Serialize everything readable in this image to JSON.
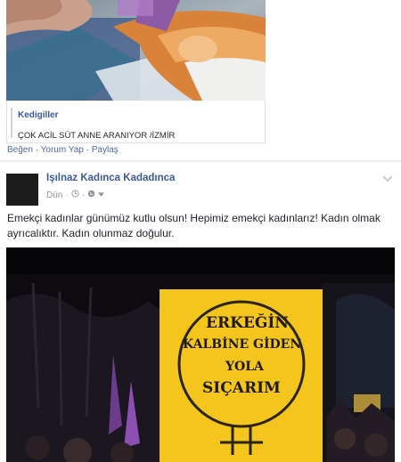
{
  "shared_post": {
    "page_name": "Kedigiller",
    "description": "ÇOK ACİL SÜT ANNE ARANIYOR /İZMİR",
    "actions": {
      "like": "Beğen",
      "comment": "Yorum Yap",
      "share": "Paylaş",
      "separator": "·"
    }
  },
  "post": {
    "author": "Işılnaz Kadınca Kadadınca",
    "time": "Dün",
    "separator": "·",
    "icons": [
      "clock-icon",
      "globe-icon",
      "chevron-down-icon"
    ],
    "text": "Emekçi kadınlar günümüz kutlu olsun! Hepimiz emekçi kadınlarız! Kadın olmak ayrıcalıktır. Kadın olunmaz doğulur.",
    "image_sign": {
      "line1": "ERKEĞİN",
      "line2": "KALBİNE GİDEN",
      "line3": "YOLA",
      "line4": "SIÇARIM"
    }
  },
  "colors": {
    "link": "#3b5998",
    "sign_yellow": "#f4c51c",
    "background": "#e9ebee"
  }
}
